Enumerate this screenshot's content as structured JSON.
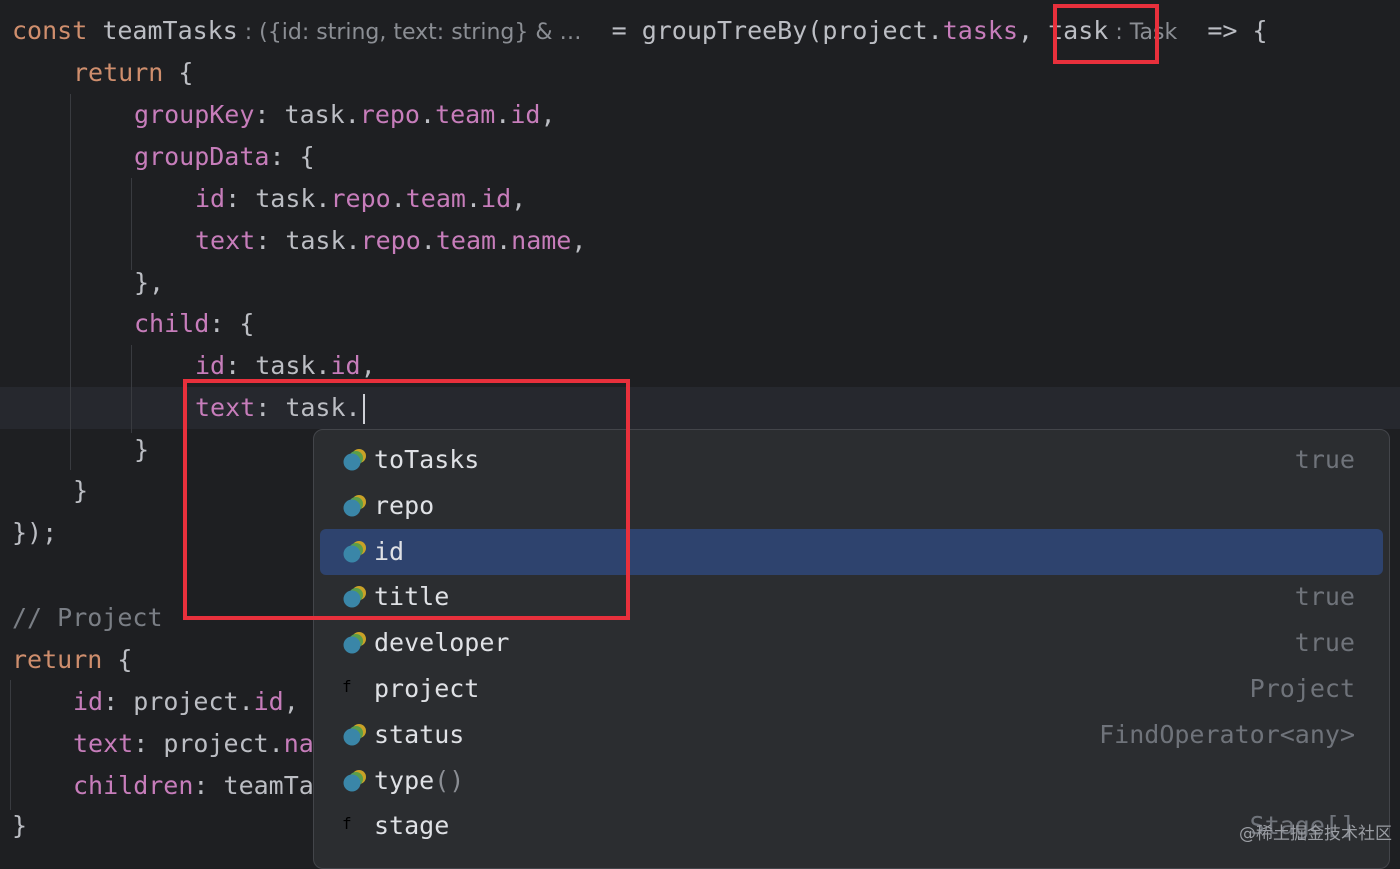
{
  "editor": {
    "line1": {
      "kw_const": "const",
      "name": " teamTasks",
      "type_hint": " : ({id: string, text: string} & …",
      "assign": "  = groupTreeBy(project.",
      "tasks_prop": "tasks",
      "comma": ", ",
      "param": "task",
      "param_hint": " : Task",
      "arrow": "  => {"
    },
    "line2": {
      "kw": "return",
      "rest": " {"
    },
    "line3": {
      "prop": "groupKey",
      "a": ": task.",
      "p1": "repo",
      "d1": ".",
      "p2": "team",
      "d2": ".",
      "p3": "id",
      "end": ","
    },
    "line4": {
      "prop": "groupData",
      "rest": ": {"
    },
    "line5": {
      "prop": "id",
      "a": ": task.",
      "p1": "repo",
      "d1": ".",
      "p2": "team",
      "d2": ".",
      "p3": "id",
      "end": ","
    },
    "line6": {
      "prop": "text",
      "a": ": task.",
      "p1": "repo",
      "d1": ".",
      "p2": "team",
      "d2": ".",
      "p3": "name",
      "end": ","
    },
    "line7": {
      "text": "},"
    },
    "line8": {
      "prop": "child",
      "rest": ": {"
    },
    "line9": {
      "prop": "id",
      "a": ": task.",
      "p1": "id",
      "end": ","
    },
    "line10": {
      "prop": "text",
      "a": ": task."
    },
    "line11": {
      "text": "}"
    },
    "line12": {
      "text": "}"
    },
    "line13": {
      "text": "});"
    },
    "line14": {
      "comment": "// Project"
    },
    "line15": {
      "kw": "return",
      "rest": " {"
    },
    "line16": {
      "prop": "id",
      "a": ": project.",
      "p1": "id",
      "end": ","
    },
    "line17": {
      "prop": "text",
      "a": ": project.",
      "p1": "na"
    },
    "line18": {
      "prop": "children",
      "a": ": teamTa"
    },
    "line19": {
      "text": "}"
    }
  },
  "completion": {
    "items": [
      {
        "label": "toTasks",
        "type": "true",
        "icon": "field-icon"
      },
      {
        "label": "repo",
        "type": "",
        "icon": "field-icon"
      },
      {
        "label": "id",
        "type": "",
        "icon": "field-icon",
        "selected": true
      },
      {
        "label": "title",
        "type": "true",
        "icon": "field-icon"
      },
      {
        "label": "developer",
        "type": "true",
        "icon": "field-icon"
      },
      {
        "label": "project",
        "type": "Project",
        "icon": "function-icon"
      },
      {
        "label": "status",
        "type": "FindOperator<any>",
        "icon": "field-icon"
      },
      {
        "label": "type",
        "parens": "()",
        "type": "",
        "icon": "field-icon"
      },
      {
        "label": "stage",
        "type": "Stage[]",
        "icon": "function-icon"
      }
    ]
  },
  "watermark": "@稀土掘金技术社区",
  "colors": {
    "background": "#1e1f22",
    "popup": "#2b2d30",
    "selection": "#2e436e",
    "highlight_box": "#e8303c"
  }
}
